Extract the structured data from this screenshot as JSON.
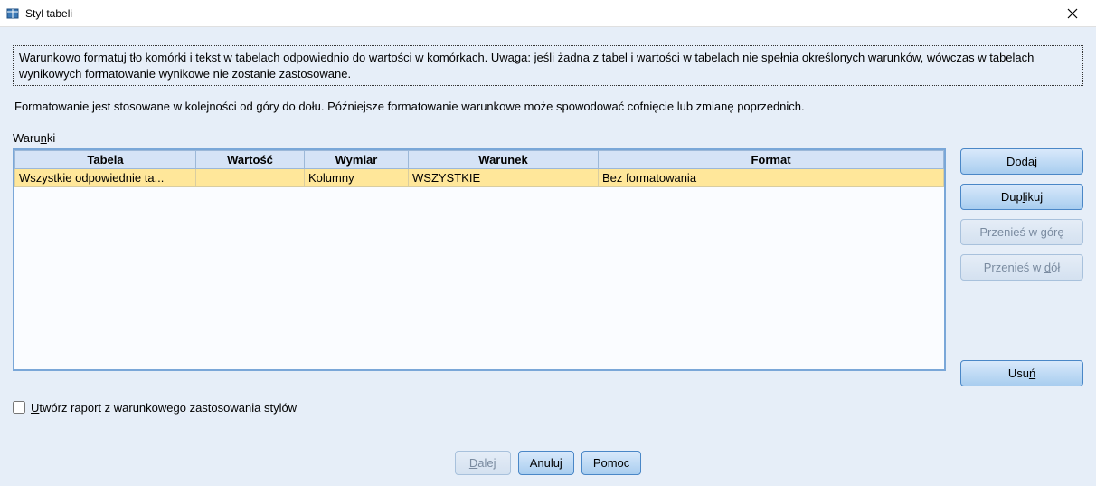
{
  "window": {
    "title": "Styl tabeli"
  },
  "intro": "Warunkowo formatuj tło komórki i tekst w tabelach odpowiednio do wartości w komórkach. Uwaga: jeśli żadna z tabel i wartości w tabelach nie spełnia określonych warunków, wówczas w tabelach wynikowych formatowanie wynikowe nie zostanie zastosowane.",
  "subinfo": "Formatowanie jest stosowane w kolejności od góry do dołu. Późniejsze formatowanie warunkowe może spowodować cofnięcie lub zmianę poprzednich.",
  "conditions_label": "Warunki",
  "table": {
    "headers": {
      "table": "Tabela",
      "value": "Wartość",
      "dimension": "Wymiar",
      "condition": "Warunek",
      "format": "Format"
    },
    "rows": [
      {
        "table": "Wszystkie odpowiednie ta...",
        "value": "",
        "dimension": "Kolumny",
        "condition": "WSZYSTKIE",
        "format": "Bez formatowania"
      }
    ]
  },
  "buttons": {
    "add": "Dodaj",
    "duplicate": "Duplikuj",
    "move_up": "Przenieś w górę",
    "move_down": "Przenieś w dół",
    "delete": "Usuń",
    "next": "Dalej",
    "cancel": "Anuluj",
    "help": "Pomoc"
  },
  "checkbox": {
    "label": "Utwórz raport z warunkowego zastosowania stylów"
  }
}
